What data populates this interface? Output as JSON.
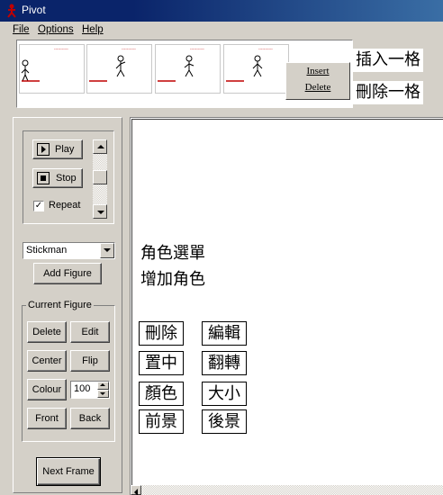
{
  "window": {
    "title": "Pivot"
  },
  "menu": {
    "file": "File",
    "options": "Options",
    "help": "Help"
  },
  "frames": {
    "count": 4,
    "context_menu": {
      "insert": "Insert",
      "delete": "Delete"
    }
  },
  "annotations": {
    "insert_frame": "插入一格",
    "delete_frame": "刪除一格",
    "figure_menu": "角色選單",
    "add_figure": "增加角色",
    "delete": "刪除",
    "edit": "編輯",
    "center": "置中",
    "flip": "翻轉",
    "colour": "顏色",
    "size": "大小",
    "front": "前景",
    "back": "後景"
  },
  "controls": {
    "play": "Play",
    "stop": "Stop",
    "repeat": "Repeat",
    "repeat_checked": true,
    "figure_select": "Stickman",
    "add_figure": "Add Figure",
    "current_figure_group": "Current Figure",
    "delete": "Delete",
    "edit": "Edit",
    "center": "Center",
    "flip": "Flip",
    "colour": "Colour",
    "size_value": "100",
    "front": "Front",
    "back": "Back",
    "next_frame": "Next Frame"
  },
  "icons": {
    "app": "pivot-stickman-icon",
    "play": "play-icon",
    "stop": "stop-icon"
  },
  "colors": {
    "title_bar": "#0a246a",
    "stickman_ground": "#c00000",
    "face": "#d4d0c8"
  }
}
